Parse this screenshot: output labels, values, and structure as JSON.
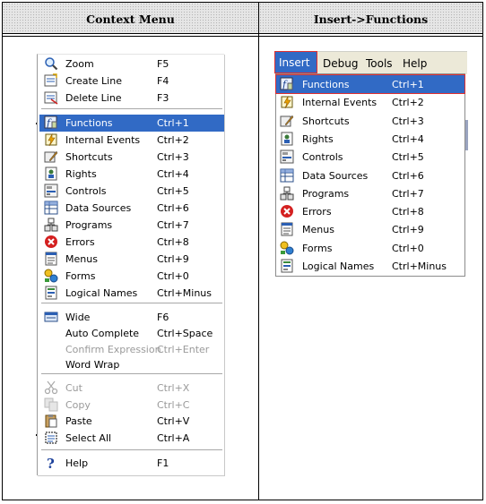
{
  "headers": {
    "left": "Context Menu",
    "right": "Insert->Functions"
  },
  "context_menu": {
    "groups": [
      [
        {
          "label": "Zoom",
          "shortcut": "F5",
          "icon": "zoom-icon"
        },
        {
          "label": "Create Line",
          "shortcut": "F4",
          "icon": "create-line-icon"
        },
        {
          "label": "Delete Line",
          "shortcut": "F3",
          "icon": "delete-line-icon"
        }
      ],
      [
        {
          "label": "Functions",
          "shortcut": "Ctrl+1",
          "icon": "functions-icon",
          "highlighted": true
        },
        {
          "label": "Internal Events",
          "shortcut": "Ctrl+2",
          "icon": "internal-events-icon"
        },
        {
          "label": "Shortcuts",
          "shortcut": "Ctrl+3",
          "icon": "shortcuts-icon"
        },
        {
          "label": "Rights",
          "shortcut": "Ctrl+4",
          "icon": "rights-icon"
        },
        {
          "label": "Controls",
          "shortcut": "Ctrl+5",
          "icon": "controls-icon"
        },
        {
          "label": "Data Sources",
          "shortcut": "Ctrl+6",
          "icon": "data-sources-icon"
        },
        {
          "label": "Programs",
          "shortcut": "Ctrl+7",
          "icon": "programs-icon"
        },
        {
          "label": "Errors",
          "shortcut": "Ctrl+8",
          "icon": "errors-icon"
        },
        {
          "label": "Menus",
          "shortcut": "Ctrl+9",
          "icon": "menus-icon"
        },
        {
          "label": "Forms",
          "shortcut": "Ctrl+0",
          "icon": "forms-icon"
        },
        {
          "label": "Logical Names",
          "shortcut": "Ctrl+Minus",
          "icon": "logical-names-icon"
        }
      ],
      [
        {
          "label": "Wide",
          "shortcut": "F6",
          "icon": "wide-icon"
        },
        {
          "label": "Auto Complete",
          "shortcut": "Ctrl+Space",
          "icon": ""
        },
        {
          "label": "Confirm Expression",
          "shortcut": "Ctrl+Enter",
          "icon": "",
          "disabled": true
        },
        {
          "label": "Word Wrap",
          "shortcut": "",
          "icon": ""
        }
      ],
      [
        {
          "label": "Cut",
          "shortcut": "Ctrl+X",
          "icon": "cut-icon",
          "disabled": true
        },
        {
          "label": "Copy",
          "shortcut": "Ctrl+C",
          "icon": "copy-icon",
          "disabled": true
        },
        {
          "label": "Paste",
          "shortcut": "Ctrl+V",
          "icon": "paste-icon"
        },
        {
          "label": "Select All",
          "shortcut": "Ctrl+A",
          "icon": "select-all-icon"
        }
      ],
      [
        {
          "label": "Help",
          "shortcut": "F1",
          "icon": "help-icon"
        }
      ]
    ]
  },
  "menubar": {
    "items": [
      {
        "label": "Insert",
        "active": true
      },
      {
        "label": "Debug"
      },
      {
        "label": "Tools"
      },
      {
        "label": "Help"
      }
    ]
  },
  "insert_menu": {
    "items": [
      {
        "label": "Functions",
        "shortcut": "Ctrl+1",
        "icon": "functions-icon",
        "highlighted": true
      },
      {
        "label": "Internal Events",
        "shortcut": "Ctrl+2",
        "icon": "internal-events-icon"
      },
      {
        "label": "Shortcuts",
        "shortcut": "Ctrl+3",
        "icon": "shortcuts-icon"
      },
      {
        "label": "Rights",
        "shortcut": "Ctrl+4",
        "icon": "rights-icon"
      },
      {
        "label": "Controls",
        "shortcut": "Ctrl+5",
        "icon": "controls-icon"
      },
      {
        "label": "Data Sources",
        "shortcut": "Ctrl+6",
        "icon": "data-sources-icon"
      },
      {
        "label": "Programs",
        "shortcut": "Ctrl+7",
        "icon": "programs-icon"
      },
      {
        "label": "Errors",
        "shortcut": "Ctrl+8",
        "icon": "errors-icon"
      },
      {
        "label": "Menus",
        "shortcut": "Ctrl+9",
        "icon": "menus-icon"
      },
      {
        "label": "Forms",
        "shortcut": "Ctrl+0",
        "icon": "forms-icon"
      },
      {
        "label": "Logical Names",
        "shortcut": "Ctrl+Minus",
        "icon": "logical-names-icon"
      }
    ]
  },
  "colors": {
    "highlight": "#316ac5",
    "outline": "#e03030",
    "menubar": "#ece9d8",
    "disabled": "#9a9a9a"
  }
}
